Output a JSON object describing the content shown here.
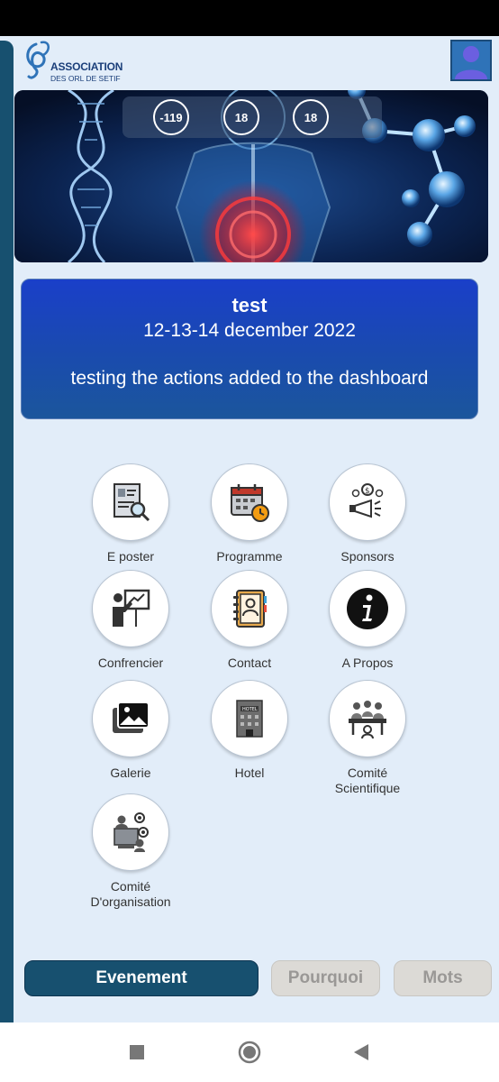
{
  "header": {
    "logo_line1": "ASSOCIATION",
    "logo_line2": "DES ORL DE SETIF",
    "logo_icon": "association-logo",
    "avatar_icon": "user-avatar-icon"
  },
  "banner": {
    "counters": [
      "-119",
      "18",
      "18"
    ]
  },
  "event": {
    "title": "test",
    "date": "12-13-14 december 2022",
    "description": "testing the actions added to the dashboard"
  },
  "menu": [
    {
      "label": "E poster",
      "icon": "resume-search-icon"
    },
    {
      "label": "Programme",
      "icon": "calendar-clock-icon"
    },
    {
      "label": "Sponsors",
      "icon": "megaphone-money-icon"
    },
    {
      "label": "Confrencier",
      "icon": "presenter-board-icon"
    },
    {
      "label": "Contact",
      "icon": "address-book-icon"
    },
    {
      "label": "A Propos",
      "icon": "info-icon"
    },
    {
      "label": "Galerie",
      "icon": "image-gallery-icon"
    },
    {
      "label": "Hotel",
      "icon": "hotel-building-icon"
    },
    {
      "label": "Comité\nScientifique",
      "icon": "committee-table-icon"
    },
    {
      "label": "Comité\nD'organisation",
      "icon": "organization-team-icon"
    }
  ],
  "tabs": [
    {
      "label": "Evenement",
      "active": true
    },
    {
      "label": "Pourquoi",
      "active": false
    },
    {
      "label": "Mots",
      "active": false
    }
  ],
  "colors": {
    "primary": "#17506f",
    "card_gradient_top": "#1a3fc9",
    "background": "#e2edf9",
    "inactive_tab": "#dcdad6"
  }
}
